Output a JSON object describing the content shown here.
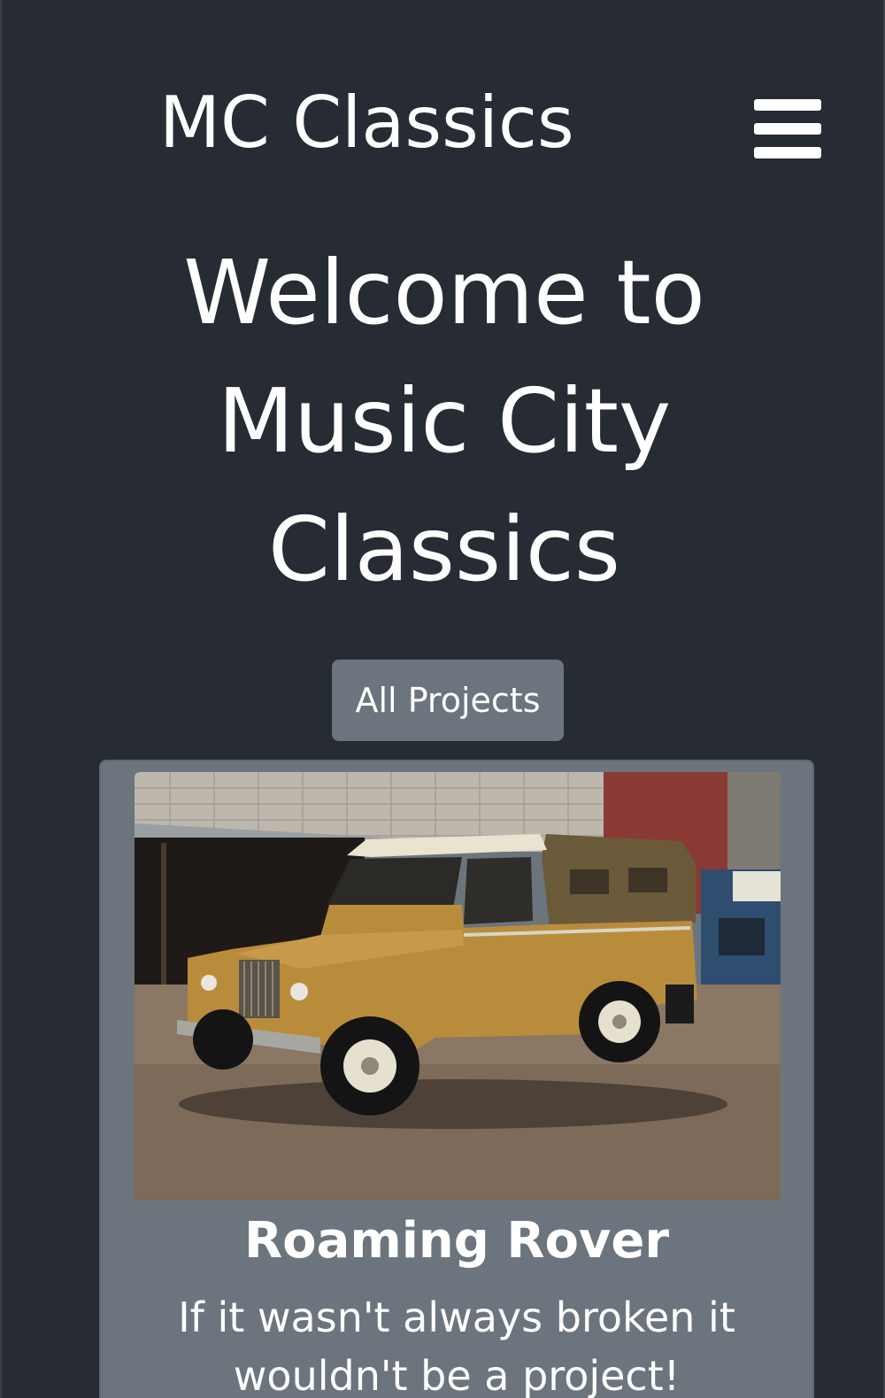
{
  "navbar": {
    "brand": "MC Classics",
    "menu_icon": "hamburger-menu-icon"
  },
  "hero": {
    "title": "Welcome to Music City Classics"
  },
  "actions": {
    "all_projects_label": "All Projects"
  },
  "card": {
    "image_subject": "tan Land Rover Series truck with canvas top parked in front of a brick warehouse",
    "title": "Roaming Rover",
    "text": "If it wasn't always broken it wouldn't be a project!"
  },
  "colors": {
    "background": "#272b33",
    "button": "#6c757d",
    "card": "#6c757d",
    "text": "#ffffff",
    "truck_body": "#b98c3c",
    "truck_top": "#6b5a3a"
  }
}
